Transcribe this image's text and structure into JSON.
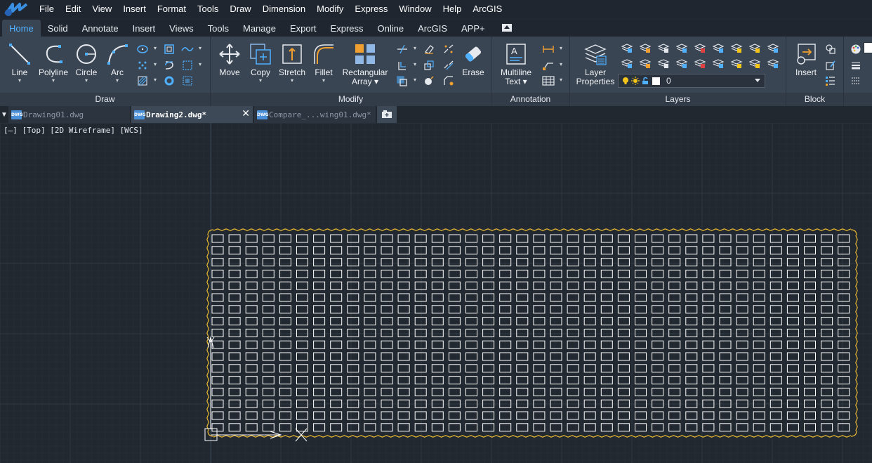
{
  "menubar": {
    "items": [
      "File",
      "Edit",
      "View",
      "Insert",
      "Format",
      "Tools",
      "Draw",
      "Dimension",
      "Modify",
      "Express",
      "Window",
      "Help",
      "ArcGIS"
    ]
  },
  "ribbon_tabs": {
    "items": [
      "Home",
      "Solid",
      "Annotate",
      "Insert",
      "Views",
      "Tools",
      "Manage",
      "Export",
      "Express",
      "Online",
      "ArcGIS",
      "APP+"
    ],
    "active": "Home"
  },
  "panels": {
    "draw": {
      "title": "Draw",
      "line": "Line",
      "polyline": "Polyline",
      "circle": "Circle",
      "arc": "Arc"
    },
    "modify": {
      "title": "Modify",
      "move": "Move",
      "copy": "Copy",
      "stretch": "Stretch",
      "fillet": "Fillet",
      "array_l1": "Rectangular",
      "array_l2": "Array",
      "erase": "Erase"
    },
    "annotation": {
      "title": "Annotation",
      "mtext_l1": "Multiline",
      "mtext_l2": "Text"
    },
    "layers": {
      "title": "Layers",
      "props_l1": "Layer",
      "props_l2": "Properties",
      "current_layer": "0"
    },
    "block": {
      "title": "Block",
      "insert": "Insert"
    }
  },
  "file_tabs": [
    {
      "name": "Drawing01.dwg",
      "active": false
    },
    {
      "name": "Drawing2.dwg*",
      "active": true
    },
    {
      "name": "Compare_...wing01.dwg*",
      "active": false
    }
  ],
  "viewport": {
    "label": "[—] [Top] [2D Wireframe] [WCS]"
  },
  "drawing": {
    "grid_rows": 17,
    "grid_cols": 38,
    "boundary_color": "#e8b830",
    "cell_color": "#ffffff",
    "grid_line_color": "#2b333e"
  },
  "colors": {
    "accent": "#4fb0ff",
    "ribbon_bg": "#3a4553",
    "canvas_bg": "#212830"
  }
}
